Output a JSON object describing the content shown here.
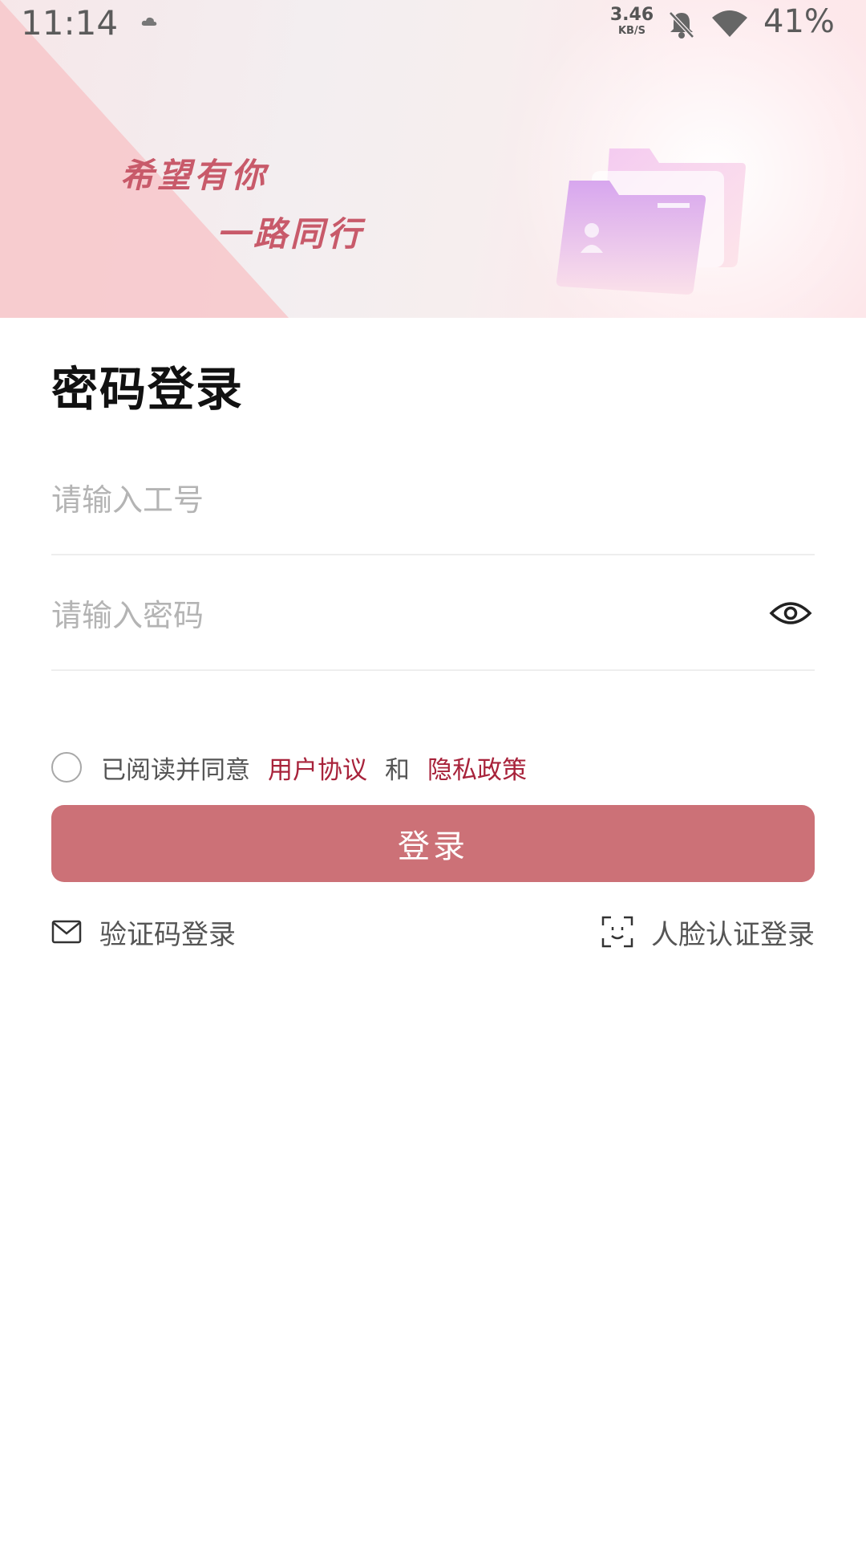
{
  "status_bar": {
    "time": "11:14",
    "net_speed_value": "3.46",
    "net_speed_unit": "KB/S",
    "battery": "41%"
  },
  "banner": {
    "slogan_line1": "希望有你",
    "slogan_line2": "一路同行"
  },
  "form": {
    "title": "密码登录",
    "employee_id_placeholder": "请输入工号",
    "password_placeholder": "请输入密码"
  },
  "agreement": {
    "prefix": "已阅读并同意",
    "user_agreement": "用户协议",
    "and": "和",
    "privacy_policy": "隐私政策"
  },
  "login_button": "登录",
  "alt_logins": {
    "sms_code": "验证码登录",
    "face": "人脸认证登录"
  },
  "colors": {
    "primary_button": "#cc7177",
    "link": "#a8233b",
    "slogan": "#c85a6a"
  }
}
